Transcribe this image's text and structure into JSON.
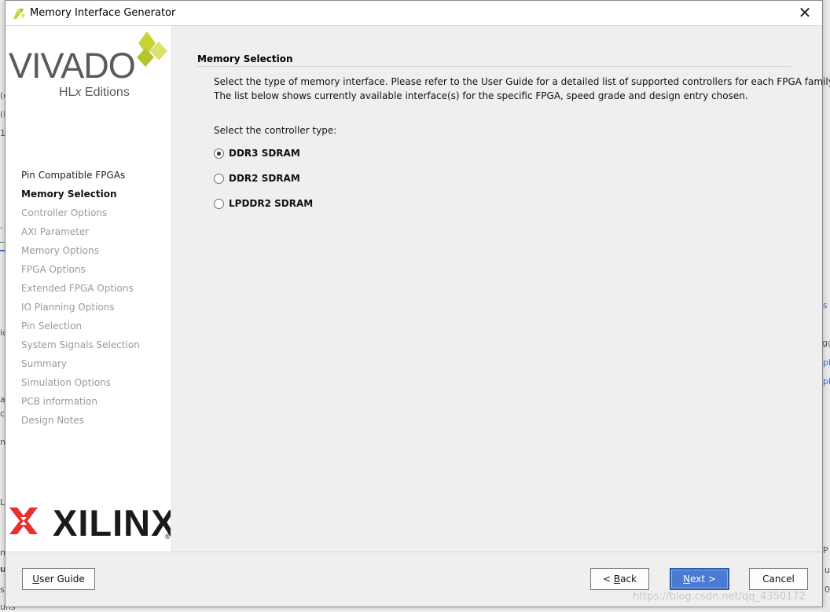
{
  "window": {
    "title": "Memory Interface Generator",
    "close_symbol": "✕"
  },
  "brand": {
    "vivado": "VIVADO",
    "edition_prefix": "HL",
    "edition_x": "x",
    "edition_suffix": " Editions",
    "xilinx": "XILINX",
    "registered": "®"
  },
  "steps": {
    "active_index": 1,
    "items": [
      "Pin Compatible FPGAs",
      "Memory Selection",
      "Controller Options",
      "AXI Parameter",
      "Memory Options",
      "FPGA Options",
      "Extended FPGA Options",
      "IO Planning Options",
      "Pin Selection",
      "System Signals Selection",
      "Summary",
      "Simulation Options",
      "PCB information",
      "Design Notes"
    ]
  },
  "main": {
    "header": "Memory Selection",
    "description_line1": "Select the type of memory interface. Please refer to the User Guide for a detailed list of supported controllers for each FPGA family.",
    "description_line2": "The list below shows currently available interface(s) for the specific FPGA, speed grade and design entry chosen.",
    "prompt": "Select the controller type:",
    "controller_types": {
      "selected_index": 0,
      "options": [
        "DDR3 SDRAM",
        "DDR2 SDRAM",
        "LPDDR2 SDRAM"
      ]
    }
  },
  "buttons": {
    "user_guide": {
      "mnemonic": "U",
      "rest": "ser Guide"
    },
    "back": {
      "prefix": "< ",
      "mnemonic": "B",
      "rest": "ack"
    },
    "next": {
      "mnemonic": "N",
      "rest": "ext >"
    },
    "cancel": "Cancel"
  },
  "background_fragments": {
    "left": [
      "(c",
      "(i",
      "1",
      "-",
      "_i",
      "ic",
      "ate",
      "co",
      "ne",
      "L",
      "ns",
      "us",
      "s",
      "uns"
    ],
    "right": [
      "s",
      "ggl",
      "pl",
      "pl",
      "P",
      "u",
      "0"
    ]
  },
  "watermark": "https://blog.csdn.net/qq_4350172",
  "colors": {
    "accent": "#4a7bd1",
    "vivado_yellow": "#c6d433",
    "xilinx_red": "#e8302c",
    "inactive_step": "#9a9a9a"
  }
}
